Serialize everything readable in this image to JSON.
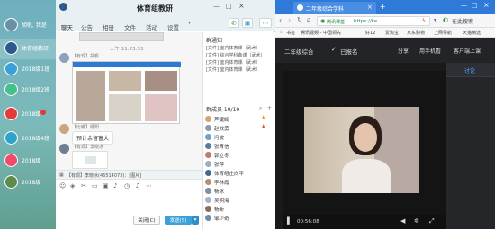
{
  "sidebar": {
    "items": [
      {
        "label": "胡帆, 我是"
      },
      {
        "label": "体育组教研"
      },
      {
        "label": "2018级1班"
      },
      {
        "label": "2018级2班"
      },
      {
        "label": "2018级"
      },
      {
        "label": "2018级4班"
      },
      {
        "label": "2018级"
      },
      {
        "label": "2018级"
      }
    ]
  },
  "chat": {
    "title": "体育组教研",
    "tabs": [
      "聊天",
      "公告",
      "相册",
      "文件",
      "活动",
      "设置"
    ],
    "time": "上午 11:23:53",
    "msg1_name": "【有现】胡帆",
    "msg2_name": "【比嗲】杨阳",
    "msg2_text": "预计余留窗大",
    "msg3_name": "【有现】李晓冰",
    "reply_tag": "【有现】李晓冰(46514073)：[图片]",
    "close_label": "关闭(C)",
    "send_label": "发送(S)"
  },
  "notice": {
    "title": "群通知",
    "lines": [
      "[文件] 室内体育课（武术）",
      "[文件] 综合学科备课（武术）",
      "[文件] 室内体育课（武术）",
      "[文件] 室内体育课（武术）"
    ]
  },
  "members": {
    "title": "群成员 19/19",
    "list": [
      "芦婕嫣",
      "赵效勇",
      "冯波",
      "张胄信",
      "郭立冬",
      "张萍",
      "体育组庄向平",
      "李林霞",
      "杨冰",
      "吴明海",
      "杨新",
      "邹少奇"
    ]
  },
  "browser": {
    "tab_title": "二年级综合学科",
    "url": "https://ke.",
    "brand": "腾讯课堂",
    "search_label": "在此搜索",
    "bookmarks": [
      "书签",
      "腾讯视频 - 中国领先",
      "好12",
      "爱淘宝",
      "京东购物",
      "上网导航",
      "天猫精选"
    ],
    "class_title": "二年级综合",
    "enrolled": "已报名",
    "share": "分享",
    "mobile": "用手机看",
    "client": "客户端上课",
    "side_tab": "讨论",
    "video_time": "00:56:08"
  },
  "colors": {
    "accent": "#2a7bc0",
    "browser_blue": "#2f79d8",
    "send_bg": "#3ba1d9"
  }
}
